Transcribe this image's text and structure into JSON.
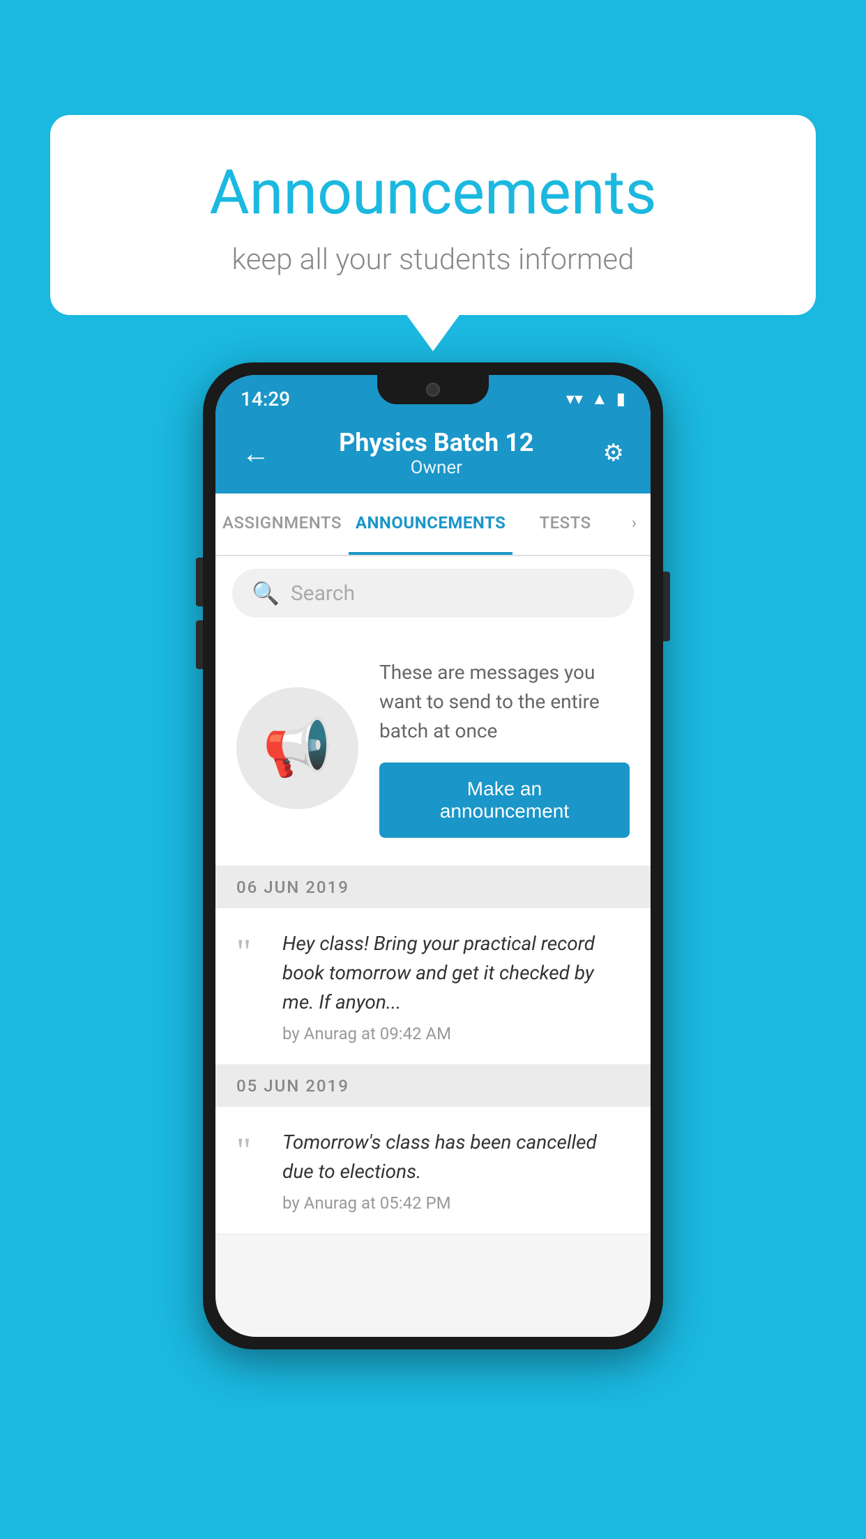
{
  "background_color": "#1bb8e0",
  "speech_bubble": {
    "title": "Announcements",
    "subtitle": "keep all your students informed"
  },
  "phone": {
    "status_bar": {
      "time": "14:29",
      "icons": [
        "wifi",
        "signal",
        "battery"
      ]
    },
    "header": {
      "title": "Physics Batch 12",
      "subtitle": "Owner",
      "back_label": "←",
      "settings_label": "⚙"
    },
    "tabs": [
      {
        "label": "ASSIGNMENTS",
        "active": false
      },
      {
        "label": "ANNOUNCEMENTS",
        "active": true
      },
      {
        "label": "TESTS",
        "active": false
      }
    ],
    "search": {
      "placeholder": "Search"
    },
    "announcement_prompt": {
      "description": "These are messages you want to send to the entire batch at once",
      "button_label": "Make an announcement"
    },
    "announcements": [
      {
        "date": "06  JUN  2019",
        "text": "Hey class! Bring your practical record book tomorrow and get it checked by me. If anyon...",
        "meta": "by Anurag at 09:42 AM"
      },
      {
        "date": "05  JUN  2019",
        "text": "Tomorrow's class has been cancelled due to elections.",
        "meta": "by Anurag at 05:42 PM"
      }
    ]
  }
}
